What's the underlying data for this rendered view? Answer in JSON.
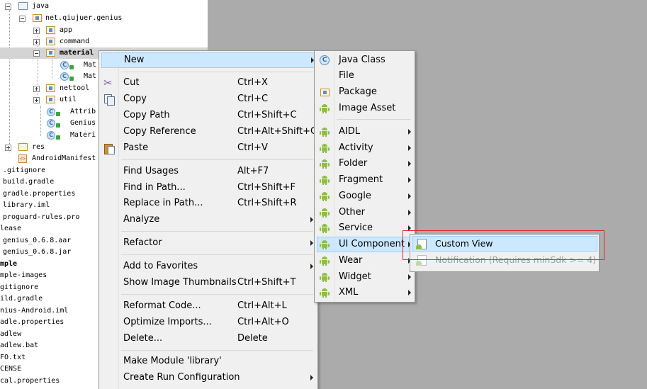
{
  "project_tree": {
    "rows": [
      {
        "label": "java"
      },
      {
        "label": "net.qiujuer.genius"
      },
      {
        "label": "app"
      },
      {
        "label": "command"
      },
      {
        "label": "material"
      },
      {
        "label": "Mat"
      },
      {
        "label": "Mat"
      },
      {
        "label": "nettool"
      },
      {
        "label": "util"
      },
      {
        "label": "Attrib"
      },
      {
        "label": "Genius"
      },
      {
        "label": "Materi"
      },
      {
        "label": "res"
      },
      {
        "label": "AndroidManifest"
      },
      {
        "label": ".gitignore"
      },
      {
        "label": "build.gradle"
      },
      {
        "label": "gradle.properties"
      },
      {
        "label": "library.iml"
      },
      {
        "label": "proguard-rules.pro"
      },
      {
        "label": "lease"
      },
      {
        "label": "genius_0.6.8.aar"
      },
      {
        "label": "genius_0.6.8.jar"
      },
      {
        "label": "mple"
      },
      {
        "label": "mple-images"
      },
      {
        "label": "gitignore"
      },
      {
        "label": "ild.gradle"
      },
      {
        "label": "nius-Android.iml"
      },
      {
        "label": "adle.properties"
      },
      {
        "label": "adlew"
      },
      {
        "label": "adlew.bat"
      },
      {
        "label": "FO.txt"
      },
      {
        "label": "CENSE"
      },
      {
        "label": "cal.properties"
      }
    ]
  },
  "context_menu": {
    "items": [
      {
        "label": "New",
        "shortcut": ""
      },
      {
        "label": "Cut",
        "shortcut": "Ctrl+X"
      },
      {
        "label": "Copy",
        "shortcut": "Ctrl+C"
      },
      {
        "label": "Copy Path",
        "shortcut": "Ctrl+Shift+C"
      },
      {
        "label": "Copy Reference",
        "shortcut": "Ctrl+Alt+Shift+C"
      },
      {
        "label": "Paste",
        "shortcut": "Ctrl+V"
      },
      {
        "label": "Find Usages",
        "shortcut": "Alt+F7"
      },
      {
        "label": "Find in Path...",
        "shortcut": "Ctrl+Shift+F"
      },
      {
        "label": "Replace in Path...",
        "shortcut": "Ctrl+Shift+R"
      },
      {
        "label": "Analyze",
        "shortcut": ""
      },
      {
        "label": "Refactor",
        "shortcut": ""
      },
      {
        "label": "Add to Favorites",
        "shortcut": ""
      },
      {
        "label": "Show Image Thumbnails",
        "shortcut": "Ctrl+Shift+T"
      },
      {
        "label": "Reformat Code...",
        "shortcut": "Ctrl+Alt+L"
      },
      {
        "label": "Optimize Imports...",
        "shortcut": "Ctrl+Alt+O"
      },
      {
        "label": "Delete...",
        "shortcut": "Delete"
      },
      {
        "label": "Make Module 'library'",
        "shortcut": ""
      },
      {
        "label": "Create Run Configuration",
        "shortcut": ""
      }
    ]
  },
  "new_submenu": {
    "items": [
      {
        "label": "Java Class"
      },
      {
        "label": "File"
      },
      {
        "label": "Package"
      },
      {
        "label": "Image Asset"
      },
      {
        "label": "AIDL"
      },
      {
        "label": "Activity"
      },
      {
        "label": "Folder"
      },
      {
        "label": "Fragment"
      },
      {
        "label": "Google"
      },
      {
        "label": "Other"
      },
      {
        "label": "Service"
      },
      {
        "label": "UI Component"
      },
      {
        "label": "Wear"
      },
      {
        "label": "Widget"
      },
      {
        "label": "XML"
      }
    ]
  },
  "ui_component_submenu": {
    "items": [
      {
        "label": "Custom View",
        "enabled": true
      },
      {
        "label": "Notification (Requires minSdk >= 4)",
        "enabled": false
      }
    ]
  },
  "colors": {
    "menu_highlight": "#cce8ff",
    "menu_background": "#f0f0f0",
    "annotation_box": "#e0262a",
    "android_green": "#8fbf3f"
  }
}
